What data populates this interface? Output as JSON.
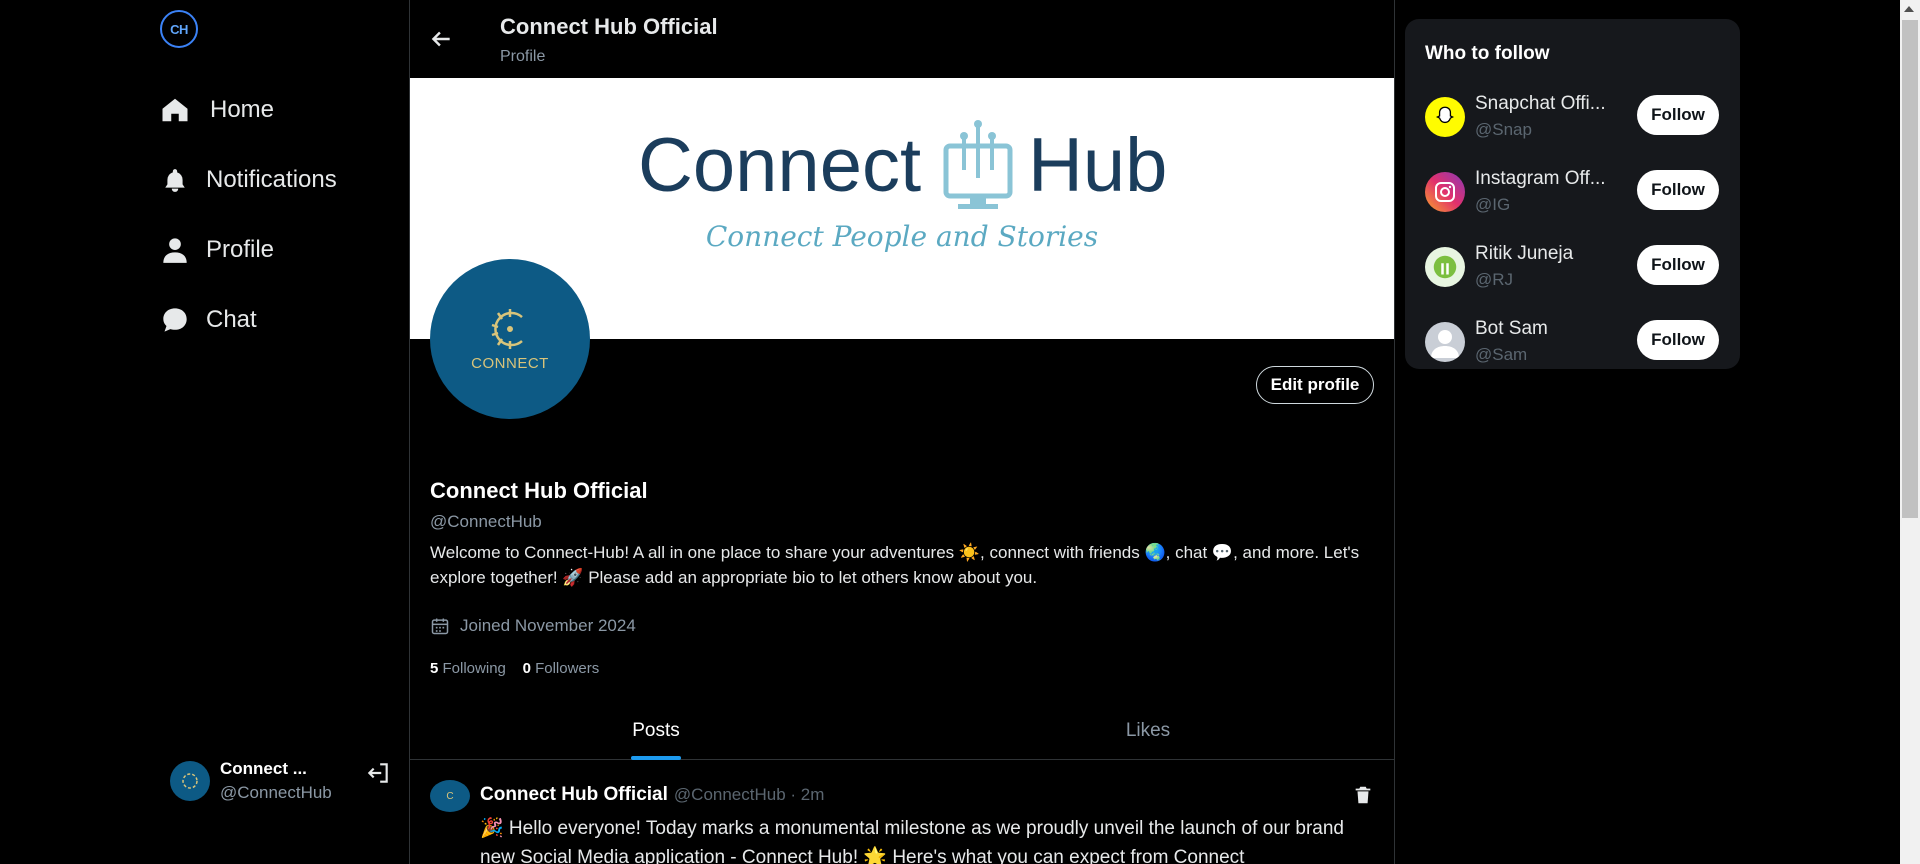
{
  "app": {
    "logo_text": "CH"
  },
  "nav": {
    "items": [
      {
        "label": "Home",
        "icon": "home-icon"
      },
      {
        "label": "Notifications",
        "icon": "bell-icon"
      },
      {
        "label": "Profile",
        "icon": "user-icon"
      },
      {
        "label": "Chat",
        "icon": "chat-bubble-icon"
      }
    ]
  },
  "account": {
    "name": "Connect ...",
    "handle": "@ConnectHub",
    "avatar_text": "C"
  },
  "header": {
    "title": "Connect Hub Official",
    "subtitle": "Profile"
  },
  "banner": {
    "word1": "Connect",
    "word2": "Hub",
    "tagline": "Connect People and Stories"
  },
  "profile": {
    "avatar_text": "CONNECT",
    "edit_label": "Edit profile",
    "name": "Connect Hub Official",
    "handle": "@ConnectHub",
    "bio": "Welcome to Connect-Hub! A all in one place to share your adventures ☀️, connect with friends 🌏, chat 💬, and more. Let's explore together! 🚀 Please add an appropriate bio to let others know about you.",
    "joined": "Joined November 2024",
    "following_count": "5",
    "following_label": "Following",
    "followers_count": "0",
    "followers_label": "Followers"
  },
  "tabs": [
    {
      "label": "Posts",
      "active": true
    },
    {
      "label": "Likes",
      "active": false
    }
  ],
  "post": {
    "avatar_text": "C",
    "name": "Connect Hub Official",
    "meta": "@ConnectHub · 2m",
    "body": "🎉 Hello everyone! Today marks a monumental milestone as we proudly unveil the launch of our brand new Social Media application - Connect Hub! 🌟 Here's what you can expect from Connect"
  },
  "who_to_follow": {
    "title": "Who to follow",
    "follow_label": "Follow",
    "users": [
      {
        "name": "Snapchat Offi...",
        "handle": "@Snap",
        "icon": "snapchat-icon",
        "color": "#fffc00"
      },
      {
        "name": "Instagram Off...",
        "handle": "@IG",
        "icon": "instagram-icon",
        "color": "#e1306c"
      },
      {
        "name": "Ritik Juneja",
        "handle": "@RJ",
        "icon": "user-avatar-icon",
        "color": "#e8f5e1"
      },
      {
        "name": "Bot Sam",
        "handle": "@Sam",
        "icon": "default-avatar-icon",
        "color": "#c9ced6"
      }
    ]
  },
  "colors": {
    "accent": "#1d9bf0",
    "brand_dark": "#1b3d5c",
    "brand_avatar": "#0d5a85"
  }
}
